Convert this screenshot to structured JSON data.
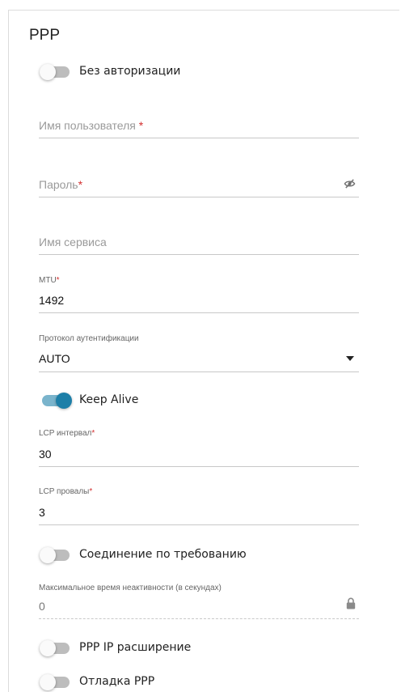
{
  "section": {
    "title": "PPP"
  },
  "no_auth_toggle": {
    "label": "Без авторизации",
    "on": false
  },
  "username": {
    "placeholder": "Имя пользователя",
    "required_mark": "*",
    "value": ""
  },
  "password": {
    "placeholder": "Пароль",
    "required_mark": "*",
    "value": "",
    "icon": "eye-off-icon"
  },
  "service_name": {
    "placeholder": "Имя сервиса",
    "value": ""
  },
  "mtu": {
    "label": "MTU",
    "required_mark": "*",
    "value": "1492"
  },
  "auth_protocol": {
    "label": "Протокол аутентификации",
    "value": "AUTO",
    "icon": "caret-down-icon"
  },
  "keep_alive_toggle": {
    "label": "Keep Alive",
    "on": true
  },
  "lcp_interval": {
    "label": "LCP интервал",
    "required_mark": "*",
    "value": "30"
  },
  "lcp_failures": {
    "label": "LCP провалы",
    "required_mark": "*",
    "value": "3"
  },
  "on_demand_toggle": {
    "label": "Соединение по требованию",
    "on": false
  },
  "max_idle": {
    "label": "Максимальное время неактивности (в секундах)",
    "value": "0",
    "icon": "lock-icon"
  },
  "ppp_ip_ext_toggle": {
    "label": "PPP IP расширение",
    "on": false
  },
  "ppp_debug_toggle": {
    "label": "Отладка PPP",
    "on": false
  },
  "colors": {
    "accent": "#1d7fa8",
    "accent_track": "#7ab4cc",
    "required": "#d32f2f",
    "toggle_off_track": "#bdbdbd"
  }
}
